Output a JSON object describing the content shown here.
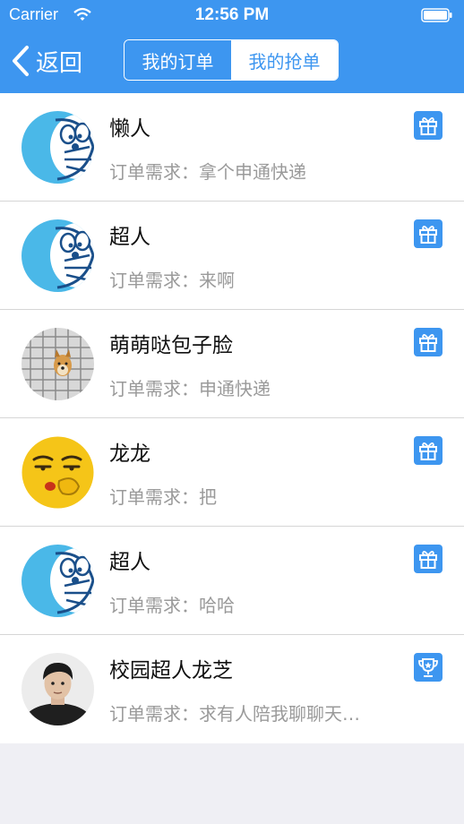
{
  "status_bar": {
    "carrier": "Carrier",
    "time": "12:56 PM"
  },
  "nav": {
    "back_label": "返回",
    "segments": [
      {
        "label": "我的订单",
        "selected": true
      },
      {
        "label": "我的抢单",
        "selected": false
      }
    ]
  },
  "colors": {
    "accent": "#3d96f0",
    "background": "#efeff4"
  },
  "orders": [
    {
      "name": "懒人",
      "requirement": "订单需求：拿个申通快递",
      "avatar": "doraemon-avatar",
      "icon": "gift-icon"
    },
    {
      "name": "超人",
      "requirement": "订单需求：来啊",
      "avatar": "doraemon-avatar",
      "icon": "gift-icon"
    },
    {
      "name": "萌萌哒包子脸",
      "requirement": "订单需求：申通快递",
      "avatar": "dog-photo-avatar",
      "icon": "gift-icon"
    },
    {
      "name": "龙龙",
      "requirement": "订单需求：把",
      "avatar": "emoji-face-avatar",
      "icon": "gift-icon"
    },
    {
      "name": "超人",
      "requirement": "订单需求：哈哈",
      "avatar": "doraemon-avatar",
      "icon": "gift-icon"
    },
    {
      "name": "校园超人龙芝",
      "requirement": "订单需求：求有人陪我聊聊天…",
      "avatar": "person-photo-avatar",
      "icon": "trophy-icon"
    }
  ]
}
